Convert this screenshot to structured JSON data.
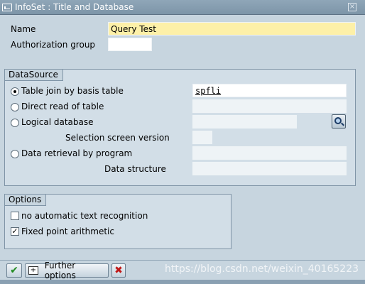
{
  "window": {
    "title": "InfoSet : Title and Database"
  },
  "header_fields": {
    "name_label": "Name",
    "name_value": "Query Test",
    "auth_label": "Authorization group",
    "auth_value": ""
  },
  "datasource": {
    "title": "DataSource",
    "options": [
      {
        "label": "Table join by basis table",
        "value": "spfli",
        "selected": true
      },
      {
        "label": "Direct read of table",
        "value": "",
        "selected": false
      },
      {
        "label": "Logical database",
        "value": "",
        "selected": false
      },
      {
        "label": "Data retrieval by program",
        "value": "",
        "selected": false
      }
    ],
    "selection_screen_label": "Selection screen version",
    "selection_screen_value": "",
    "data_structure_label": "Data structure",
    "data_structure_value": ""
  },
  "options": {
    "title": "Options",
    "items": [
      {
        "label": "no automatic text recognition",
        "checked": false
      },
      {
        "label": "Fixed point arithmetic",
        "checked": true
      }
    ]
  },
  "toolbar": {
    "further_options_label": "Further options"
  },
  "watermark": "https://blog.csdn.net/weixin_40165223",
  "colors": {
    "accent_green": "#1f8a1f",
    "cancel_red": "#c01818",
    "required_field": "#fdf0a8"
  }
}
